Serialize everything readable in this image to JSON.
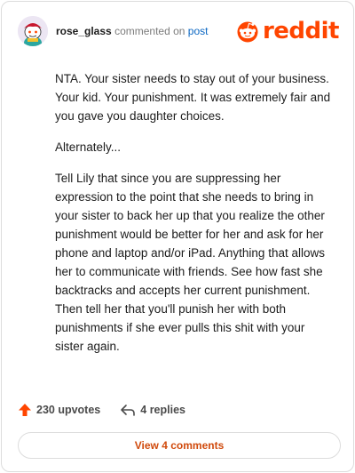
{
  "header": {
    "username": "rose_glass",
    "commented_text": "commented on",
    "post_link": "post",
    "brand": "reddit",
    "brand_color": "#ff4500",
    "avatar_icon": "snoo-avatar-icon"
  },
  "comment": {
    "paragraphs": [
      "NTA. Your sister needs to stay out of your business. Your kid. Your punishment. It was extremely fair and you gave you daughter choices.",
      "Alternately...",
      "Tell Lily that since you are suppressing her expression to the point that she needs to bring in your sister to back her up that you realize the other punishment would be better for her and ask for her phone and laptop and/or iPad. Anything that allows her to communicate with friends. See how fast she backtracks and accepts her current punishment. Then tell her that you'll punish her with both punishments if she ever pulls this shit with your sister again."
    ]
  },
  "actions": {
    "upvotes": "230 upvotes",
    "replies": "4 replies",
    "upvote_icon": "upvote-arrow-icon",
    "reply_icon": "reply-arrow-icon",
    "upvote_color": "#ff4500"
  },
  "footer": {
    "view_comments": "View 4 comments",
    "accent_color": "#d04a0c"
  }
}
